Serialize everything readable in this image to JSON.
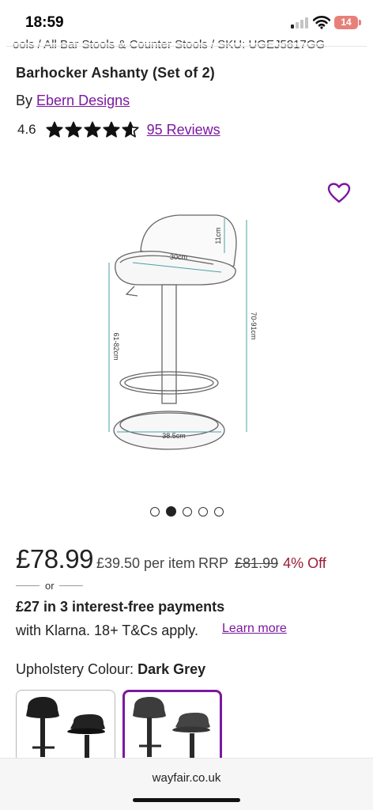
{
  "status_bar": {
    "time": "18:59",
    "battery_level": "14",
    "battery_color": "#e8807a"
  },
  "breadcrumb": "ools  /  All Bar Stools & Counter Stools  /  SKU: UGEJ5817GG",
  "product": {
    "title": "Barhocker Ashanty (Set of 2)",
    "by_label": "By",
    "brand": "Ebern Designs",
    "rating": "4.6",
    "stars_value": 4.6,
    "reviews": "95 Reviews"
  },
  "image": {
    "dim_seat_depth": "11cm",
    "dim_seat_width": "30cm",
    "dim_total_height": "70-91cm",
    "dim_seat_height": "61-82cm",
    "dim_base": "38.5cm"
  },
  "carousel": {
    "count": 5,
    "active_index": 1
  },
  "pricing": {
    "price": "£78.99",
    "per_item": "£39.50 per item",
    "rrp_label": "RRP",
    "rrp_value": "£81.99",
    "discount": "4% Off"
  },
  "klarna": {
    "or": "or",
    "headline": "£27 in 3 interest-free payments",
    "sub": "with Klarna. 18+ T&Cs apply.",
    "learn_more": "Learn more"
  },
  "options": {
    "label": "Upholstery Colour:",
    "selected": "Dark Grey"
  },
  "browser": {
    "domain": "wayfair.co.uk"
  },
  "colors": {
    "brand_purple": "#7b189f",
    "discount_red": "#9c1b33"
  }
}
